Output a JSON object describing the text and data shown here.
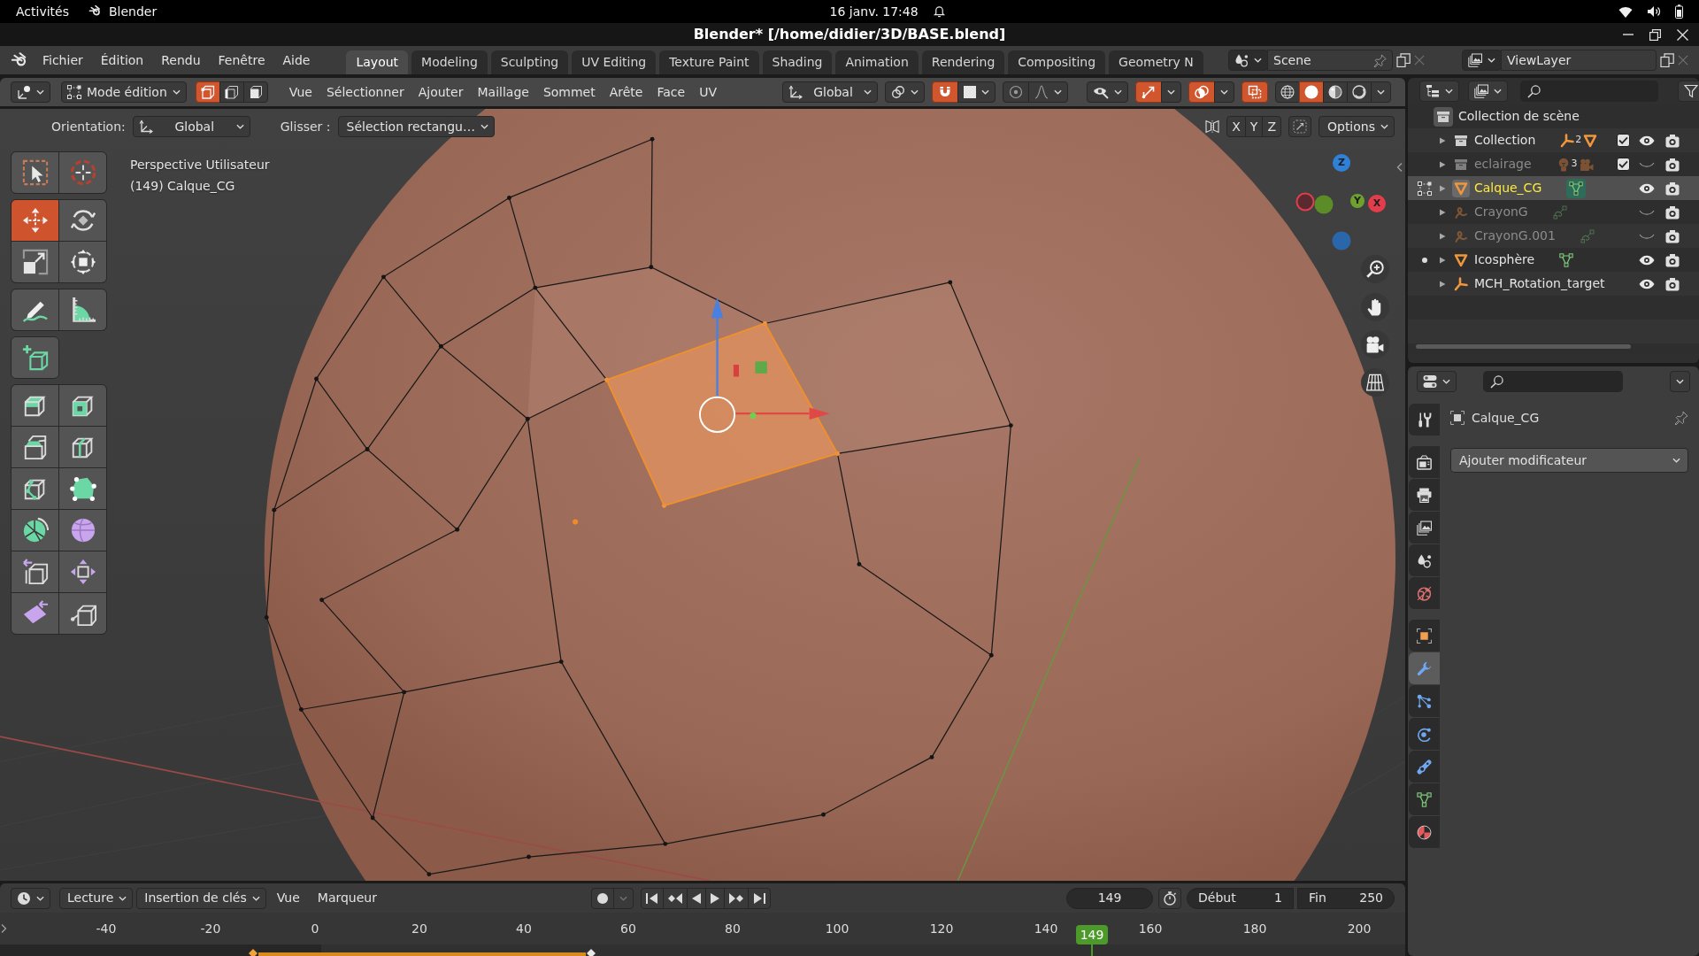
{
  "system_bar": {
    "activities": "Activités",
    "app": "Blender",
    "clock": "16 janv. 17:48"
  },
  "window": {
    "title": "Blender* [/home/didier/3D/BASE.blend]"
  },
  "topbar": {
    "menus": [
      "Fichier",
      "Édition",
      "Rendu",
      "Fenêtre",
      "Aide"
    ],
    "workspaces": [
      {
        "label": "Layout",
        "selected": true
      },
      {
        "label": "Modeling",
        "selected": false
      },
      {
        "label": "Sculpting",
        "selected": false
      },
      {
        "label": "UV Editing",
        "selected": false
      },
      {
        "label": "Texture Paint",
        "selected": false
      },
      {
        "label": "Shading",
        "selected": false
      },
      {
        "label": "Animation",
        "selected": false
      },
      {
        "label": "Rendering",
        "selected": false
      },
      {
        "label": "Compositing",
        "selected": false
      },
      {
        "label": "Geometry N",
        "selected": false
      }
    ],
    "scene": "Scene",
    "view_layer": "ViewLayer"
  },
  "viewport_header": {
    "mode": "Mode édition",
    "select_modes": [
      {
        "kind": "vertex",
        "selected": true
      },
      {
        "kind": "edge",
        "selected": false
      },
      {
        "kind": "face",
        "selected": false
      }
    ],
    "menus": [
      "Vue",
      "Sélectionner",
      "Ajouter",
      "Maillage",
      "Sommet",
      "Arête",
      "Face",
      "UV"
    ],
    "orientation": "Global",
    "snap": {
      "on": true
    },
    "proportional_editing": {
      "on": false
    },
    "toggles": [
      {
        "kind": "gizmo",
        "on": true
      },
      {
        "kind": "overlay",
        "on": true
      },
      {
        "kind": "xray",
        "on": true
      }
    ],
    "shading": [
      {
        "kind": "wireframe",
        "selected": false
      },
      {
        "kind": "solid",
        "selected": true
      },
      {
        "kind": "material",
        "selected": false
      },
      {
        "kind": "rendered",
        "selected": false
      }
    ]
  },
  "tool_settings": {
    "orientation_label": "Orientation:",
    "orientation": "Global",
    "drag_label": "Glisser :",
    "drag": "Sélection rectangu…",
    "mirror": [
      {
        "label": "X",
        "on": false
      },
      {
        "label": "Y",
        "on": false
      },
      {
        "label": "Z",
        "on": false
      }
    ],
    "options": "Options"
  },
  "toolbar": [
    {
      "tools": [
        {
          "kind": "select_box",
          "selected": false
        },
        {
          "kind": "cursor",
          "selected": false
        }
      ]
    },
    {
      "tools": [
        {
          "kind": "move",
          "selected": true
        },
        {
          "kind": "rotate",
          "selected": false
        },
        {
          "kind": "scale",
          "selected": false
        },
        {
          "kind": "transform",
          "selected": false
        }
      ]
    },
    {
      "tools": [
        {
          "kind": "annotate",
          "selected": false
        },
        {
          "kind": "measure",
          "selected": false
        }
      ]
    },
    {
      "tools": [
        {
          "kind": "add_cube",
          "selected": false
        }
      ]
    },
    {
      "tools": [
        {
          "kind": "extrude",
          "selected": false
        },
        {
          "kind": "inset",
          "selected": false
        },
        {
          "kind": "bevel",
          "selected": false
        },
        {
          "kind": "loop_cut",
          "selected": false
        },
        {
          "kind": "knife",
          "selected": false
        },
        {
          "kind": "poly_build",
          "selected": false
        },
        {
          "kind": "spin",
          "selected": false
        },
        {
          "kind": "smooth",
          "selected": false
        },
        {
          "kind": "edge_slide",
          "selected": false
        },
        {
          "kind": "shrink_fatten",
          "selected": false
        },
        {
          "kind": "shear",
          "selected": false
        },
        {
          "kind": "rip",
          "selected": false
        }
      ]
    }
  ],
  "viewport": {
    "view_name": "Perspective Utilisateur",
    "object_info": "(149) Calque_CG",
    "axes": [
      {
        "label": "Z",
        "color": "#2f81d8"
      },
      {
        "label": "Y",
        "color": "#6ea22d"
      },
      {
        "label": "X",
        "color": "#e33d4c"
      }
    ]
  },
  "outliner": {
    "root": "Collection de scène",
    "items": [
      {
        "name": "Collection",
        "kind": "collection",
        "expanded": false,
        "selected": false,
        "visible": true,
        "checked": true,
        "contents": [
          {
            "kind": "empty",
            "count": "2",
            "active": false
          },
          {
            "kind": "mesh",
            "active": false
          }
        ]
      },
      {
        "name": "eclairage",
        "kind": "collection",
        "expanded": false,
        "selected": false,
        "visible": false,
        "checked": true,
        "contents": [
          {
            "kind": "light",
            "count": "3",
            "active": false
          },
          {
            "kind": "camera",
            "active": false
          }
        ]
      },
      {
        "name": "Calque_CG",
        "kind": "mesh",
        "expanded": false,
        "selected": true,
        "visible": true,
        "marker": {
          "kind": "edit"
        },
        "contents": [
          {
            "kind": "mesh_data",
            "active": true
          }
        ]
      },
      {
        "name": "CrayonG",
        "kind": "grease_pencil",
        "expanded": false,
        "selected": false,
        "visible": false,
        "contents": [
          {
            "kind": "stroke_data",
            "active": false
          }
        ]
      },
      {
        "name": "CrayonG.001",
        "kind": "grease_pencil",
        "expanded": false,
        "selected": false,
        "visible": false,
        "contents": [
          {
            "kind": "stroke_data",
            "active": false
          }
        ]
      },
      {
        "name": "Icosphère",
        "kind": "mesh",
        "expanded": false,
        "selected": false,
        "visible": true,
        "marker": {
          "kind": "dot"
        },
        "contents": [
          {
            "kind": "mesh_data",
            "active": false
          }
        ]
      },
      {
        "name": "MCH_Rotation_target",
        "kind": "empty",
        "expanded": false,
        "selected": false,
        "visible": true
      }
    ]
  },
  "properties": {
    "tab_groups": [
      {
        "tabs": [
          {
            "kind": "tool",
            "selected": false
          }
        ]
      },
      {
        "tabs": [
          {
            "kind": "render",
            "selected": false
          },
          {
            "kind": "output",
            "selected": false
          },
          {
            "kind": "view_layer",
            "selected": false
          },
          {
            "kind": "scene",
            "selected": false
          },
          {
            "kind": "world",
            "selected": false
          }
        ]
      },
      {
        "tabs": [
          {
            "kind": "object",
            "selected": false
          },
          {
            "kind": "modifiers",
            "selected": true
          },
          {
            "kind": "particles",
            "selected": false
          },
          {
            "kind": "physics",
            "selected": false
          },
          {
            "kind": "constraints",
            "selected": false
          },
          {
            "kind": "data",
            "selected": false
          },
          {
            "kind": "material",
            "selected": false
          }
        ]
      }
    ],
    "object_name": "Calque_CG",
    "add_modifier": "Ajouter modificateur"
  },
  "timeline": {
    "menus": [
      {
        "label": "Lecture",
        "kind": "dropdown"
      },
      {
        "label": "Insertion de clés",
        "kind": "dropdown"
      },
      {
        "label": "Vue",
        "kind": "menu"
      },
      {
        "label": "Marqueur",
        "kind": "menu"
      }
    ],
    "auto_keying": {
      "on": false
    },
    "current_frame": "149",
    "start_label": "Début",
    "start": "1",
    "end_label": "Fin",
    "end": "250",
    "ruler": [
      {
        "label": "-40",
        "current": false
      },
      {
        "label": "-20",
        "current": false
      },
      {
        "label": "0",
        "current": false
      },
      {
        "label": "20",
        "current": false
      },
      {
        "label": "40",
        "current": false
      },
      {
        "label": "60",
        "current": false
      },
      {
        "label": "80",
        "current": false
      },
      {
        "label": "100",
        "current": false
      },
      {
        "label": "120",
        "current": false
      },
      {
        "label": "140",
        "current": false
      },
      {
        "label": "149",
        "current": true
      },
      {
        "label": "160",
        "current": false
      },
      {
        "label": "180",
        "current": false
      },
      {
        "label": "200",
        "current": false
      }
    ],
    "keyframes": [
      {
        "selected": true
      },
      {
        "selected": false
      }
    ]
  }
}
